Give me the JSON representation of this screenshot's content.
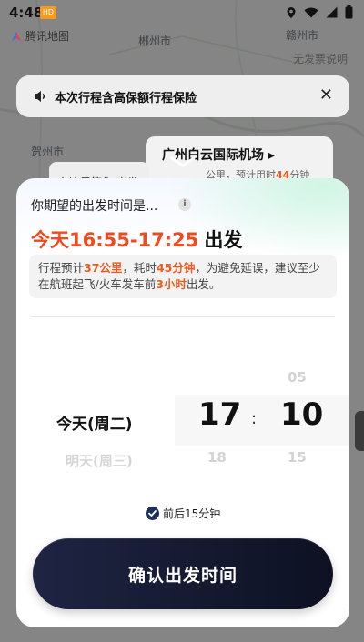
{
  "status_bar": {
    "time": "4:48",
    "badge": "HD"
  },
  "map": {
    "logo_text": "腾讯地图",
    "cities": [
      "郴州市",
      "赣州市",
      "贺州市"
    ],
    "no_invoice": "无发票说明"
  },
  "insurance_banner": {
    "text": "本次行程含高保额行程保险",
    "close_glyph": "✕"
  },
  "airport_card": {
    "name": "广州白云国际机场 ▸",
    "sub_prefix": "公里，预计用时",
    "sub_value": "44",
    "sub_suffix": "分钟"
  },
  "left_card": {
    "text": "在这里等你 出发"
  },
  "sheet": {
    "question": "你期望的出发时间是...",
    "info_glyph": "i",
    "range_time": "今天16:55-17:25",
    "range_suffix": "出发",
    "tip": {
      "p1": "行程预计",
      "distance": "37公里",
      "p2": "，耗时",
      "duration": "45分钟",
      "p3": "，为避免延误，建议至少在航班起飞/火车发车前",
      "advance": "3小时",
      "p4": "出发。"
    },
    "picker": {
      "day_selected": "今天(周二)",
      "day_next": "明天(周三)",
      "hour_selected": "17",
      "hour_next": "18",
      "minute_prev": "05",
      "minute_selected": "10",
      "minute_next": "15",
      "separator": ":"
    },
    "flex_label": "前后15分钟",
    "confirm_label": "确认出发时间"
  },
  "colors": {
    "accent": "#f04a1f",
    "button": "#1a1f3a",
    "check": "#1f2f5c"
  }
}
